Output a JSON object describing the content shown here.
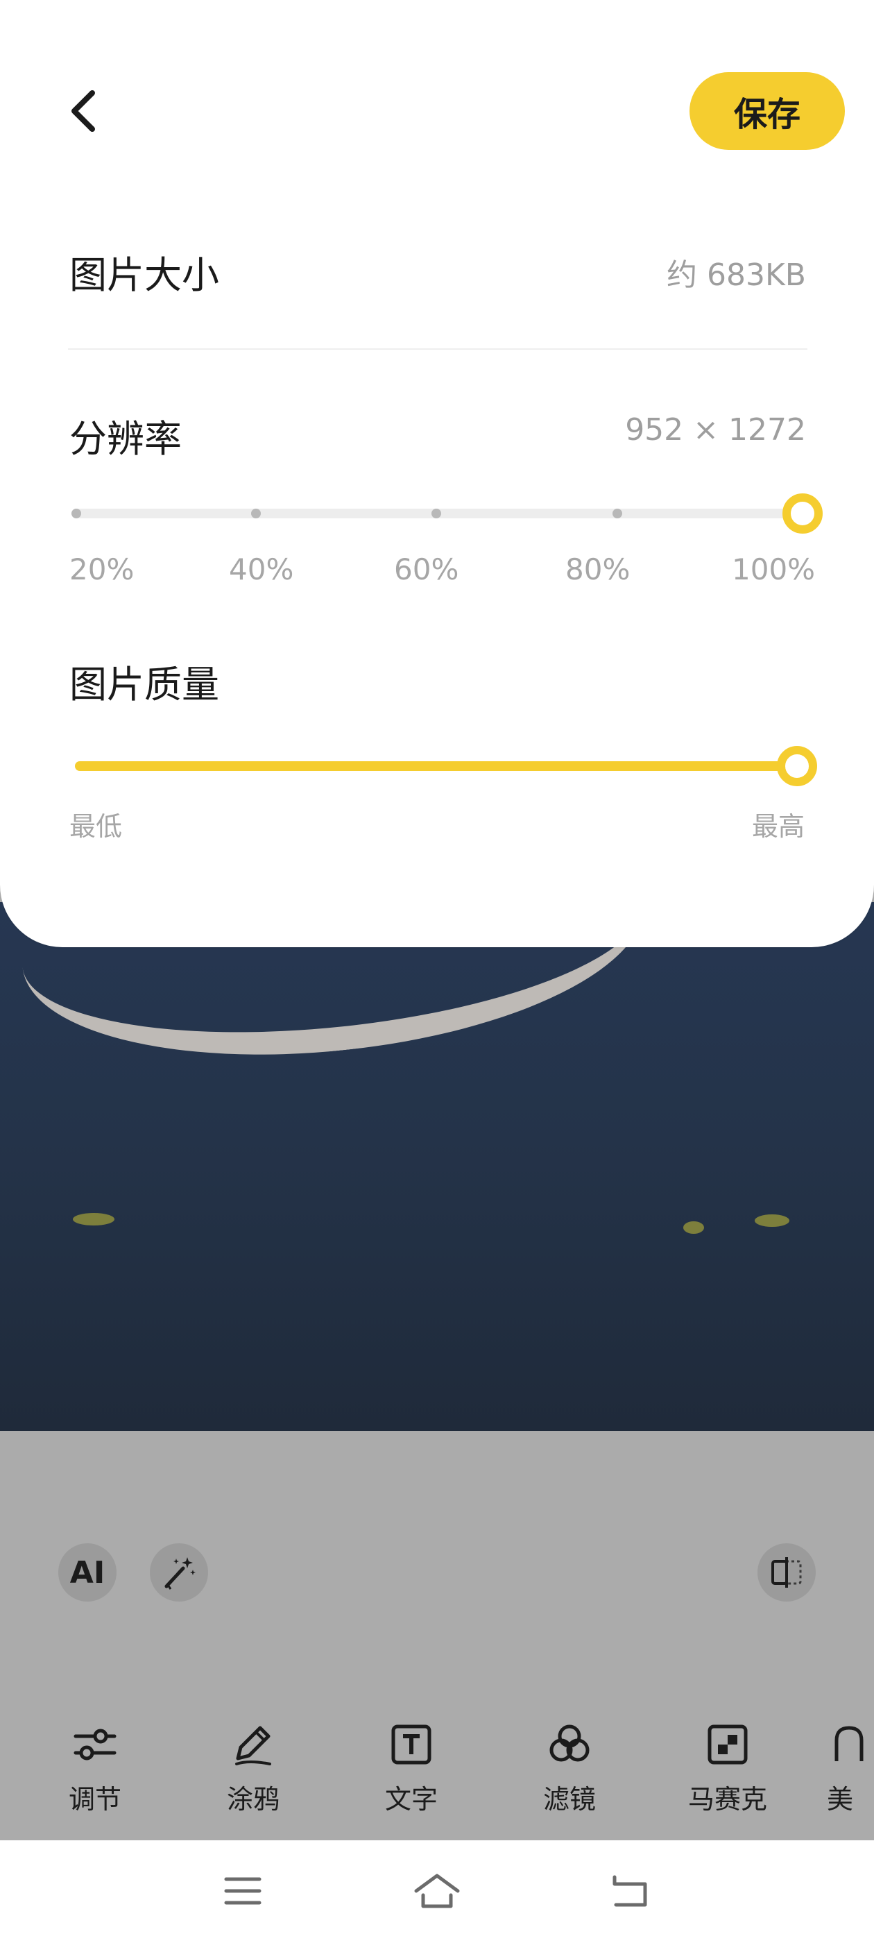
{
  "header": {
    "save_label": "保存"
  },
  "size_row": {
    "title": "图片大小",
    "value": "约 683KB"
  },
  "resolution": {
    "title": "分辨率",
    "value": "952 × 1272",
    "options": [
      "20%",
      "40%",
      "60%",
      "80%",
      "100%"
    ],
    "selected": "100%"
  },
  "quality": {
    "title": "图片质量",
    "min_label": "最低",
    "max_label": "最高",
    "level": 1.0
  },
  "floating": {
    "ai_label": "AI"
  },
  "tools": [
    {
      "label": "调节",
      "icon": "sliders-icon"
    },
    {
      "label": "涂鸦",
      "icon": "pencil-icon"
    },
    {
      "label": "文字",
      "icon": "text-box-icon"
    },
    {
      "label": "滤镜",
      "icon": "filter-circles-icon"
    },
    {
      "label": "马赛克",
      "icon": "mosaic-icon"
    },
    {
      "label": "美",
      "icon": "beauty-icon"
    }
  ],
  "colors": {
    "accent": "#f5cd2f",
    "panel": "#ffffff",
    "overlay": "#ababab"
  }
}
